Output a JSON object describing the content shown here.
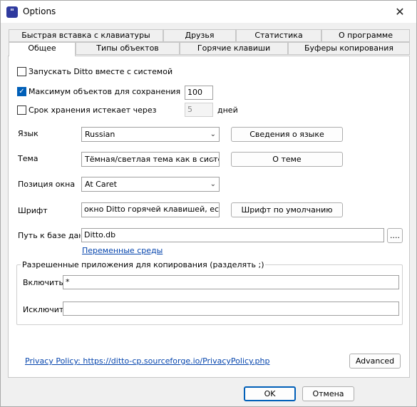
{
  "window": {
    "title": "Options",
    "app_icon_glyph": "\"",
    "close_glyph": "✕"
  },
  "tabs": {
    "row1": [
      "Быстрая вставка с клавиатуры",
      "Друзья",
      "Статистика",
      "О программе"
    ],
    "row2": [
      "Общее",
      "Типы объектов",
      "Горячие клавиши",
      "Буферы копирования"
    ],
    "active": "Общее"
  },
  "general": {
    "start_with_windows": {
      "label": "Запускать Ditto вместе с системой",
      "checked": false
    },
    "max_items": {
      "label": "Максимум объектов для сохранения",
      "checked": true,
      "value": "100"
    },
    "expire": {
      "label": "Срок хранения истекает через",
      "checked": false,
      "value": "5",
      "unit": "дней"
    },
    "language": {
      "label": "Язык",
      "value": "Russian",
      "button": "Сведения о языке"
    },
    "theme": {
      "label": "Тема",
      "value": "Тёмная/светлая тема как в систе",
      "button": "О теме"
    },
    "window_position": {
      "label": "Позиция окна",
      "value": "At Caret"
    },
    "font": {
      "label": "Шрифт",
      "value": "окно Ditto горячей клавишей, если он",
      "button": "Шрифт по умолчанию"
    },
    "db_path": {
      "label": "Путь к базе данн",
      "value": "Ditto.db",
      "browse": "....",
      "env_link": "Переменные среды"
    },
    "allowed_apps": {
      "title": "Разрешенные приложения для копирования (разделять ;)",
      "include_label": "Включить",
      "include_value": "*",
      "exclude_label": "Исключить",
      "exclude_value": ""
    },
    "privacy_link": "Privacy Policy: https://ditto-cp.sourceforge.io/PrivacyPolicy.php",
    "advanced_button": "Advanced"
  },
  "footer": {
    "ok": "OK",
    "cancel": "Отмена"
  },
  "colors": {
    "accent": "#005fb8",
    "link": "#0645ad"
  }
}
